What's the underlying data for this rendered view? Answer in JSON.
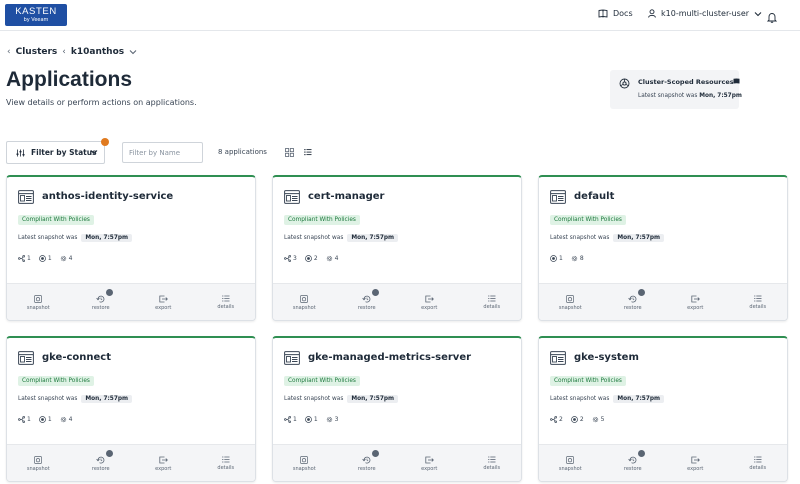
{
  "header": {
    "logo_main": "KASTEN",
    "logo_sub": "by Veeam",
    "docs_label": "Docs",
    "user_label": "k10-multi-cluster-user"
  },
  "breadcrumb": {
    "clusters": "Clusters",
    "cluster": "k10anthos"
  },
  "page": {
    "title": "Applications",
    "subtitle": "View details or perform actions on applications."
  },
  "cluster_scoped": {
    "title": "Cluster-Scoped Resources",
    "snapshot_prefix": "Latest snapshot was",
    "snapshot_time": "Mon, 7:57pm"
  },
  "filters": {
    "status_label": "Filter by Status",
    "name_placeholder": "Filter by Name",
    "count_label": "8 applications"
  },
  "card_common": {
    "badge": "Compliant With Policies",
    "snapshot_prefix": "Latest snapshot was",
    "actions": [
      "snapshot",
      "restore",
      "export",
      "details"
    ]
  },
  "apps": [
    {
      "name": "anthos-identity-service",
      "snapshot_time": "Mon, 7:57pm",
      "workloads": "1",
      "volumes": "1",
      "resources": "4"
    },
    {
      "name": "cert-manager",
      "snapshot_time": "Mon, 7:57pm",
      "workloads": "3",
      "volumes": "2",
      "resources": "4"
    },
    {
      "name": "default",
      "snapshot_time": "Mon, 7:57pm",
      "workloads": "",
      "volumes": "1",
      "resources": "8"
    },
    {
      "name": "gke-connect",
      "snapshot_time": "Mon, 7:57pm",
      "workloads": "1",
      "volumes": "1",
      "resources": "4"
    },
    {
      "name": "gke-managed-metrics-server",
      "snapshot_time": "Mon, 7:57pm",
      "workloads": "1",
      "volumes": "1",
      "resources": "3"
    },
    {
      "name": "gke-system",
      "snapshot_time": "Mon, 7:57pm",
      "workloads": "2",
      "volumes": "2",
      "resources": "5"
    }
  ]
}
